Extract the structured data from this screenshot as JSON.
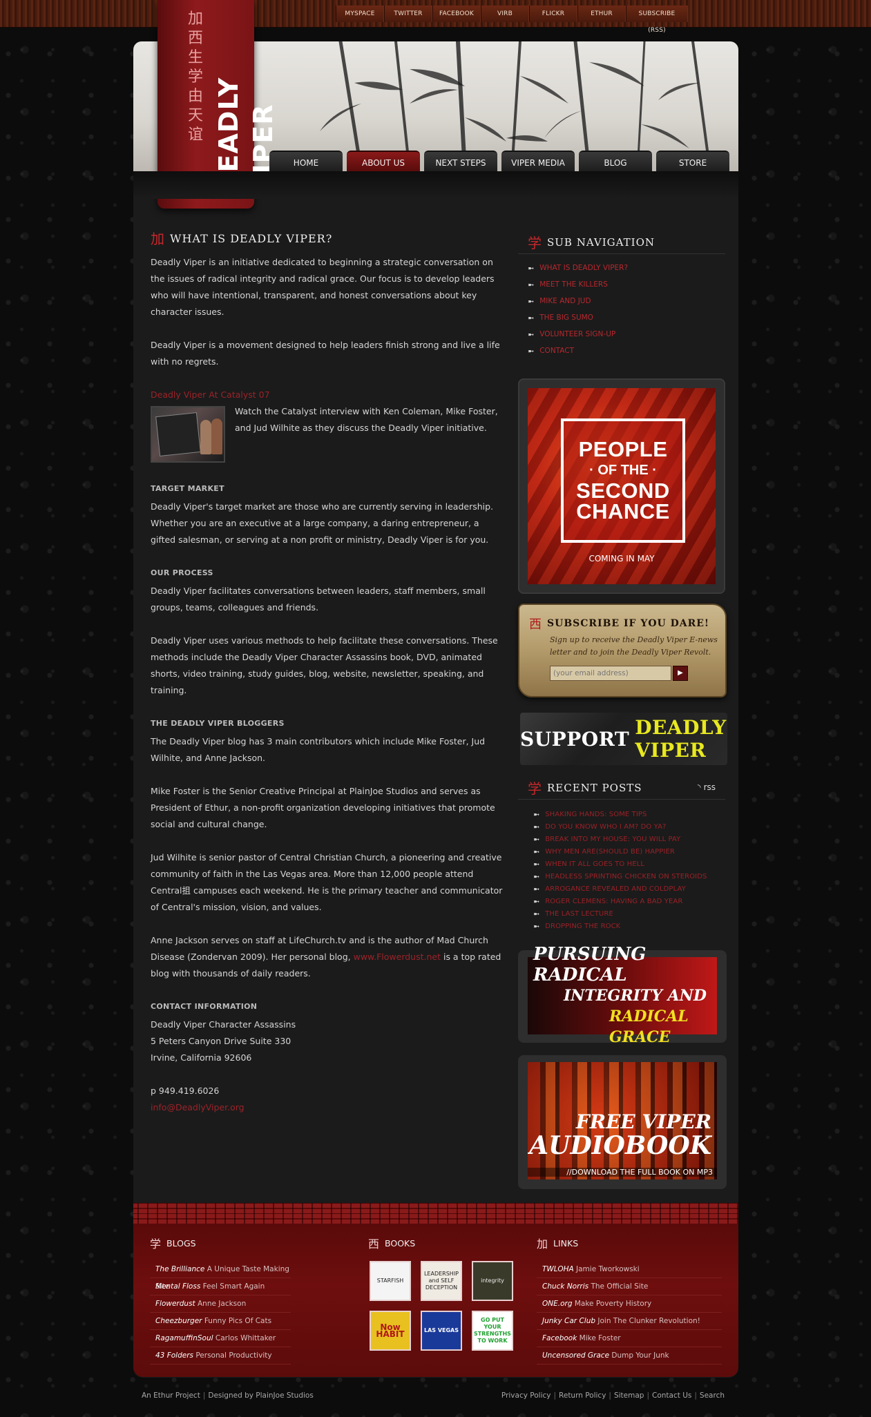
{
  "social": [
    "MYSPACE",
    "TWITTER",
    "FACEBOOK",
    "VIRB",
    "FLICKR",
    "ETHUR",
    "SUBSCRIBE (RSS)"
  ],
  "logo": {
    "chars": "加西生学由天谊",
    "title": "DEADLY VIPER"
  },
  "nav": [
    "HOME",
    "ABOUT US",
    "NEXT STEPS",
    "VIPER MEDIA",
    "BLOG",
    "STORE"
  ],
  "main": {
    "heading_glyph": "加",
    "heading": "WHAT IS DEADLY VIPER?",
    "p1": "Deadly Viper is an initiative dedicated to beginning a strategic conversation on the issues of radical integrity and radical grace. Our focus is to develop leaders who will have intentional, transparent, and honest conversations about key character issues.",
    "p2": "Deadly Viper is a movement designed to help leaders finish strong and live a life with no regrets.",
    "catalyst_link": "Deadly Viper At Catalyst 07",
    "catalyst_text": "Watch the Catalyst interview with Ken Coleman, Mike Foster, and Jud Wilhite as they discuss the Deadly Viper initiative.",
    "target_h": "TARGET MARKET",
    "target_p": "Deadly Viper's target market are those who are currently serving in leadership. Whether you are an executive at a large company, a daring entrepreneur, a gifted salesman, or serving at a non profit or ministry, Deadly Viper is for you.",
    "process_h": "OUR PROCESS",
    "process_p1": "Deadly Viper facilitates conversations between leaders, staff members, small groups, teams, colleagues and friends.",
    "process_p2": "Deadly Viper uses various methods to help facilitate these conversations. These methods include the Deadly Viper Character Assassins book, DVD, animated shorts, video training, study guides, blog, website, newsletter, speaking, and training.",
    "bloggers_h": "THE DEADLY VIPER BLOGGERS",
    "bloggers_p1": "The Deadly Viper blog has 3 main contributors which include Mike Foster, Jud Wilhite, and Anne Jackson.",
    "bloggers_p2": "Mike Foster is the Senior Creative Principal at PlainJoe Studios and serves as President of Ethur, a non-profit organization developing initiatives that promote social and cultural change.",
    "bloggers_p3": "Jud Wilhite is senior pastor of Central Christian Church, a pioneering and creative community of faith in the Las Vegas area. More than 12,000 people attend Central抯 campuses each weekend. He is the primary teacher and communicator of Central's mission, vision, and values.",
    "anne_p_a": "Anne Jackson serves on staff at LifeChurch.tv and is the author of Mad Church Disease (Zondervan 2009). Her personal blog, ",
    "anne_link": "www.Flowerdust.net",
    "anne_p_b": " is a top rated blog with thousands of daily readers.",
    "contact_h": "CONTACT INFORMATION",
    "contact_l1": "Deadly Viper Character Assassins",
    "contact_l2": "5 Peters Canyon Drive Suite 330",
    "contact_l3": "Irvine, California 92606",
    "phone": "p 949.419.6026",
    "email": "info@DeadlyViper.org"
  },
  "subnav": {
    "glyph": "学",
    "heading": "SUB NAVIGATION",
    "items": [
      "WHAT IS DEADLY VIPER?",
      "MEET THE KILLERS",
      "MIKE AND JUD",
      "THE BIG SUMO",
      "VOLUNTEER SIGN-UP",
      "CONTACT"
    ]
  },
  "people": {
    "line1": "PEOPLE",
    "line2": "· OF THE ·",
    "line3": "SECOND",
    "line4": "CHANCE",
    "coming": "COMING IN MAY"
  },
  "subscribe": {
    "glyph": "西",
    "heading": "SUBSCRIBE IF YOU DARE!",
    "desc": "Sign up to receive the Deadly Viper E-news letter and to join the Deadly Viper Revolt.",
    "placeholder": "(your email address)",
    "go": "▶"
  },
  "support": {
    "white": "SUPPORT",
    "yellow": "DEADLY VIPER"
  },
  "recent": {
    "glyph": "学",
    "heading": "RECENT POSTS",
    "rss": "rss",
    "items": [
      "SHAKING HANDS: SOME TIPS",
      "DO YOU KNOW WHO I AM? DO YA?",
      "BREAK INTO MY HOUSE: YOU WILL PAY",
      "WHY MEN ARE(SHOULD BE) HAPPIER",
      "WHEN IT ALL GOES TO HELL",
      "HEADLESS SPRINTING CHICKEN ON STEROIDS",
      "ARROGANCE REVEALED AND COLDPLAY",
      "ROGER CLEMENS: HAVING A BAD YEAR",
      "THE LAST LECTURE",
      "DROPPING THE ROCK"
    ]
  },
  "radical": {
    "l1": "PURSUING RADICAL",
    "l2": "INTEGRITY AND",
    "l3": "RADICAL GRACE"
  },
  "audio": {
    "l1": "FREE VIPER",
    "l2": "AUDIOBOOK",
    "l3": "//DOWNLOAD THE FULL BOOK ON MP3"
  },
  "footer": {
    "blogs_glyph": "学",
    "blogs_h": "BLOGS",
    "blogs": [
      {
        "name": "The Brilliance",
        "desc": "A Unique Taste Making Site"
      },
      {
        "name": "Mental Floss",
        "desc": "Feel Smart Again"
      },
      {
        "name": "Flowerdust",
        "desc": "Anne Jackson"
      },
      {
        "name": "Cheezburger",
        "desc": "Funny Pics Of Cats"
      },
      {
        "name": "RagamuffinSoul",
        "desc": "Carlos Whittaker"
      },
      {
        "name": "43 Folders",
        "desc": "Personal Productivity"
      }
    ],
    "books_glyph": "西",
    "books_h": "BOOKS",
    "books": [
      "STARFISH",
      "LEADERSHIP and SELF DECEPTION",
      "integrity",
      "Now HABIT",
      "LAS VEGAS",
      "GO PUT YOUR STRENGTHS TO WORK"
    ],
    "links_glyph": "加",
    "links_h": "LINKS",
    "links": [
      {
        "name": "TWLOHA",
        "desc": "Jamie Tworkowski"
      },
      {
        "name": "Chuck Norris",
        "desc": "The Official Site"
      },
      {
        "name": "ONE.org",
        "desc": "Make Poverty History"
      },
      {
        "name": "Junky Car Club",
        "desc": "Join The Clunker Revolution!"
      },
      {
        "name": "Facebook",
        "desc": "Mike Foster"
      },
      {
        "name": "Uncensored Grace",
        "desc": "Dump Your Junk"
      }
    ]
  },
  "bottom": {
    "left1": "An Ethur Project",
    "left2": "Designed by PlainJoe Studios",
    "right": [
      "Privacy Policy",
      "Return Policy",
      "Sitemap",
      "Contact Us",
      "Search"
    ]
  }
}
